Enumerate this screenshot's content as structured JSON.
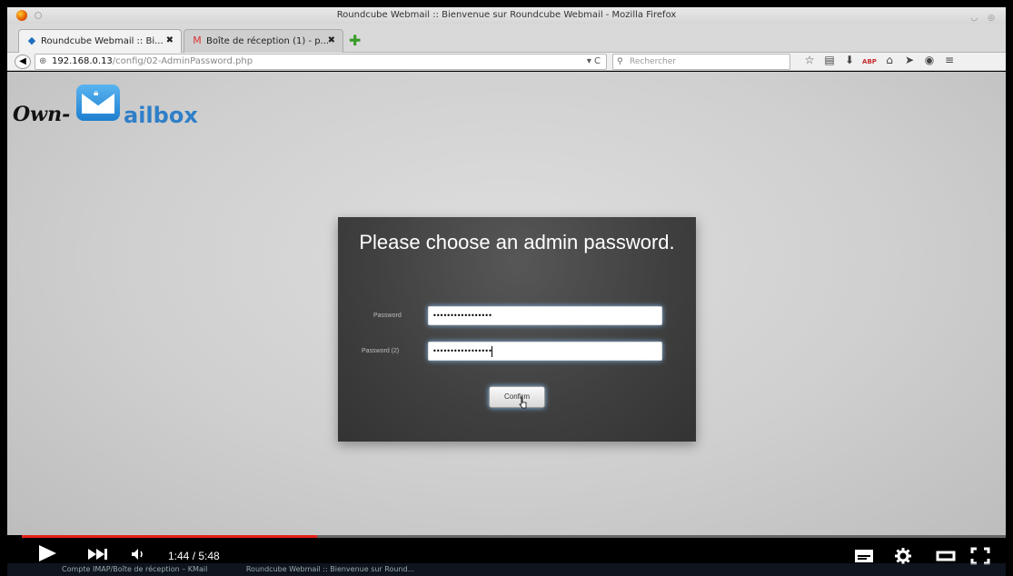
{
  "window": {
    "title": "Roundcube Webmail :: Bienvenue sur Roundcube Webmail - Mozilla Firefox"
  },
  "tabs": [
    {
      "label": "Roundcube Webmail :: Bi...",
      "close": "✖",
      "icon": "roundcube-icon"
    },
    {
      "label": "Boîte de réception (1) - p...",
      "close": "✖",
      "icon": "gmail-icon"
    }
  ],
  "newtab": "✚",
  "nav": {
    "back": "◀",
    "url_host": "192.168.0.13",
    "url_path": "/config/02-AdminPassword.php",
    "reload": "▾ C",
    "search_placeholder": "Rechercher"
  },
  "toolbar_icons": [
    "☆",
    "▤",
    "⬇",
    "ABP",
    "⌂",
    "➤",
    "◉",
    "≡"
  ],
  "logo": {
    "own": "Own-",
    "ailbox": "ailbox"
  },
  "panel": {
    "title": "Please choose an admin password.",
    "password_label": "Password",
    "password_value": "•••••••••••••••••",
    "password2_label": "Password (2)",
    "password2_value": "•••••••••••••••••",
    "confirm_label": "Confirm"
  },
  "video": {
    "time": "1:44 / 5:48",
    "progress": 0.3
  },
  "taskbar": {
    "item1": "Compte IMAP/Boîte de réception – KMail",
    "item2": "Roundcube Webmail :: Bienvenue sur Round..."
  }
}
